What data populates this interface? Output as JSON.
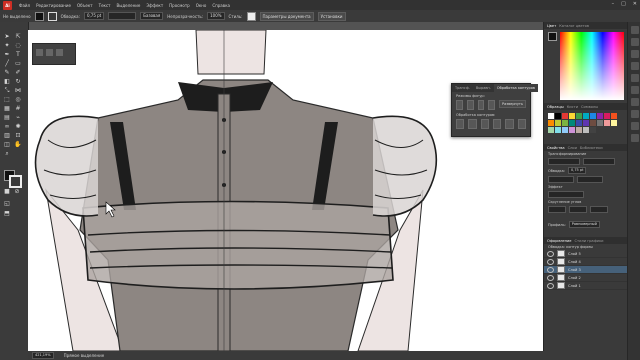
{
  "app": {
    "logo": "Ai"
  },
  "menu": [
    "Файл",
    "Редактирование",
    "Объект",
    "Текст",
    "Выделение",
    "Эффект",
    "Просмотр",
    "Окно",
    "Справка"
  ],
  "window_controls": [
    "–",
    "□",
    "✕"
  ],
  "options_bar": {
    "mode_label": "Не выделено",
    "stroke_label": "Обводка:",
    "stroke_value": "0,75 pt",
    "brush_label": "Базовая",
    "opacity_label": "Непрозрачность:",
    "opacity_value": "100%",
    "style_label": "Стиль:",
    "doc_setup": "Параметры документа",
    "prefs": "Установки"
  },
  "doc_tabs": [
    {
      "label": "Шаблон фигуры женщин.ai @ 25,01 % (CMYK/Предварительный просмотр)",
      "active": false
    },
    {
      "label": "Безымянный-7* @ 421,19 % (RGB/Предварительный просмотр)",
      "active": true
    },
    {
      "label": "Безымянный-1* @ 64,96 % (RGB/Предварительный просмотр)",
      "active": false
    }
  ],
  "canvas": {
    "colors": {
      "garment": "#8d8682",
      "skin": "#ede4e3",
      "black": "#1d1d1d",
      "line": "#2a2a2a"
    }
  },
  "pathfinder": {
    "tabs": [
      "Трансф.",
      "Выравн.",
      "Обработка контуров"
    ],
    "active_tab": 2,
    "shape_modes_label": "Режимы фигур:",
    "expand_label": "Развернуть",
    "pathfinders_label": "Обработка контуров:"
  },
  "color_panel": {
    "tabs": [
      "Цвет",
      "Каталог цветов"
    ]
  },
  "swatches_panel": {
    "tabs": [
      "Образцы",
      "Кисти",
      "Символы"
    ]
  },
  "appearance_panel": {
    "tabs": [
      "Свойства",
      "Слои",
      "Библиотеки"
    ],
    "section": "Трансформирование",
    "stroke_label": "Обводка:",
    "stroke_value": "0,75 pt",
    "fx_label": "Эффект",
    "rounding_label": "Скругление углов",
    "profile_label": "Профиль:",
    "profile_value": "Равномерный"
  },
  "layers_panel": {
    "tabs": [
      "Оформление",
      "Стили графики"
    ],
    "subtitle": "Обводка: контур формы",
    "layers": [
      {
        "name": "Слой 5",
        "selected": false
      },
      {
        "name": "Слой 4",
        "selected": false
      },
      {
        "name": "Слой 3",
        "selected": true
      },
      {
        "name": "Слой 2",
        "selected": false
      },
      {
        "name": "Слой 1",
        "selected": false
      }
    ]
  },
  "status": {
    "zoom": "421,19%",
    "tool": "Прямое выделение"
  }
}
